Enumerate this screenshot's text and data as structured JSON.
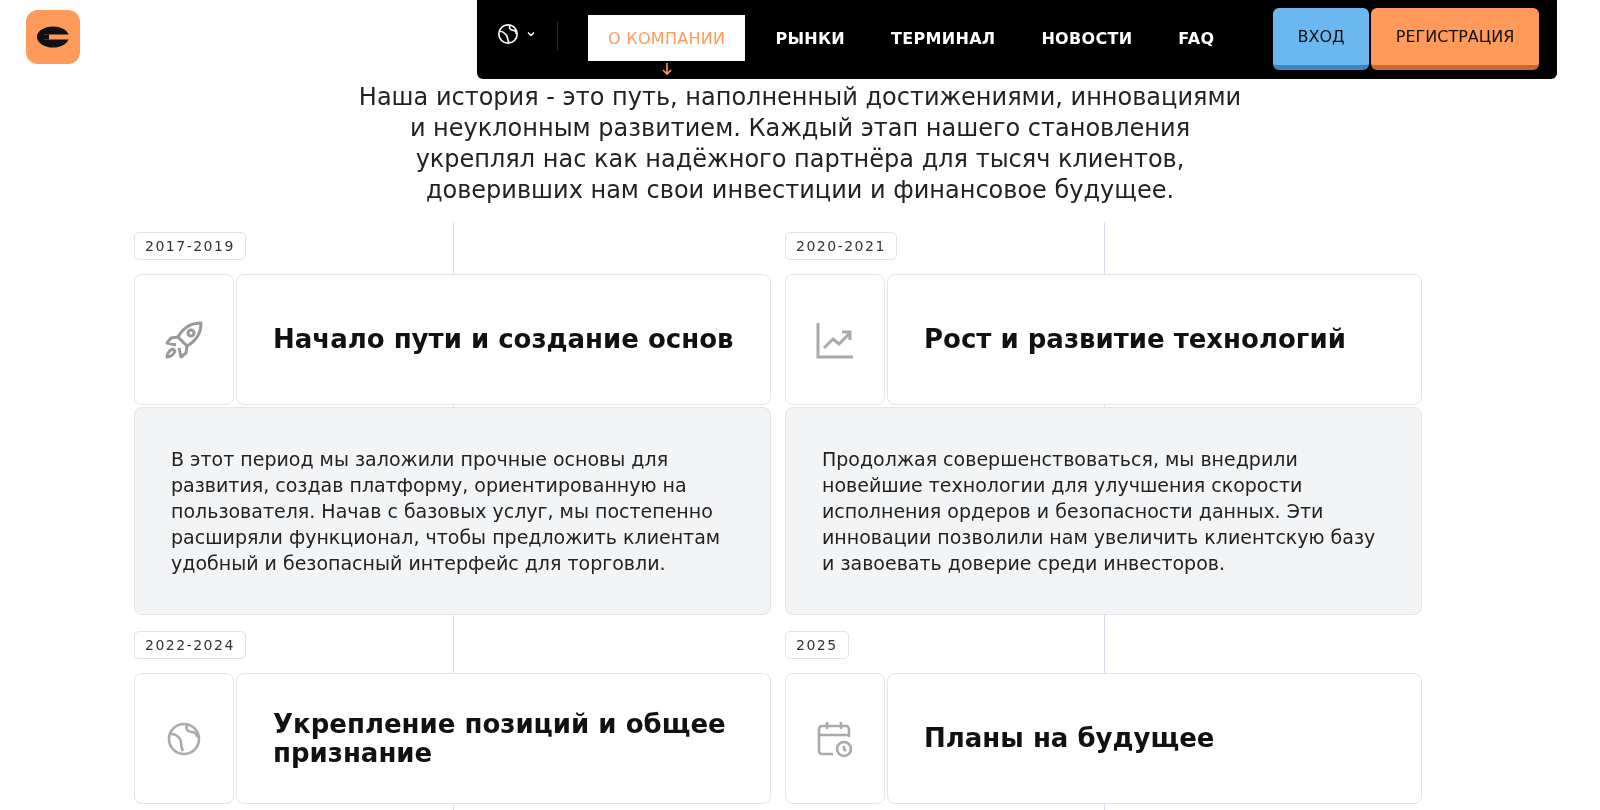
{
  "nav": {
    "items": [
      {
        "label": "О КОМПАНИИ",
        "selected": true
      },
      {
        "label": "РЫНКИ",
        "selected": false
      },
      {
        "label": "ТЕРМИНАЛ",
        "selected": false
      },
      {
        "label": "НОВОСТИ",
        "selected": false
      },
      {
        "label": "FAQ",
        "selected": false
      }
    ],
    "login": "ВХОД",
    "register": "РЕГИСТРАЦИЯ"
  },
  "intro": "Наша история - это путь, наполненный достижениями, инновациями и неуклонным развитием. Каждый этап нашего становления укреплял нас как надёжного партнёра для тысяч клиентов, доверивших нам свои инвестиции и финансовое будущее.",
  "timeline": [
    {
      "period": "2017-2019",
      "kind": "rocket",
      "title": "Начало пути и создание основ",
      "text": "В этот период мы заложили прочные основы для развития, создав платформу, ориентированную на пользователя. Начав с базовых услуг, мы постепенно расширяли функционал, чтобы предложить клиентам удобный и безопасный интерфейс для торговли."
    },
    {
      "period": "2020-2021",
      "kind": "chart",
      "title": "Рост и развитие технологий",
      "text": "Продолжая совершенствоваться, мы внедрили новейшие технологии для улучшения скорости исполнения ордеров и безопасности данных. Эти инновации позволили нам увеличить клиентскую базу и завоевать доверие среди инвесторов."
    },
    {
      "period": "2022-2024",
      "kind": "globe",
      "title": "Укрепление позиций и общее признание"
    },
    {
      "period": "2025",
      "kind": "calendar",
      "title": "Планы на будущее"
    }
  ]
}
